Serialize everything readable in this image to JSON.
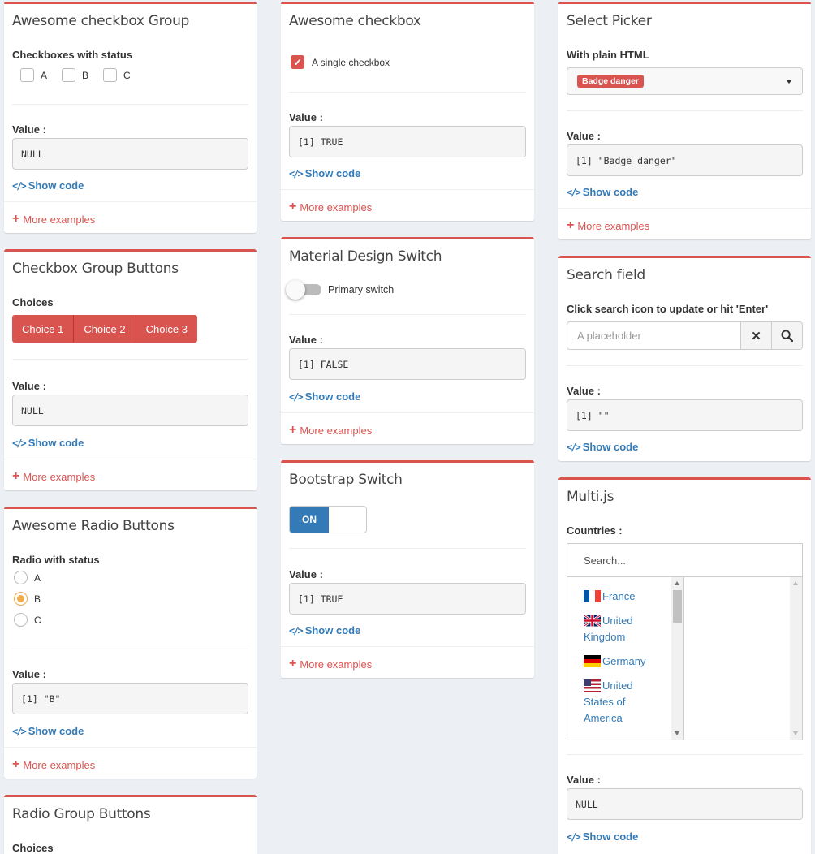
{
  "common": {
    "value_label": "Value :",
    "show_code": "Show code",
    "more_examples": "More examples"
  },
  "col1": {
    "awesome_checkbox_group": {
      "title": "Awesome checkbox Group",
      "label": "Checkboxes with status",
      "options": [
        "A",
        "B",
        "C"
      ],
      "value": "NULL"
    },
    "checkbox_group_buttons": {
      "title": "Checkbox Group Buttons",
      "label": "Choices",
      "options": [
        "Choice 1",
        "Choice 2",
        "Choice 3"
      ],
      "value": "NULL"
    },
    "awesome_radio": {
      "title": "Awesome Radio Buttons",
      "label": "Radio with status",
      "options": [
        "A",
        "B",
        "C"
      ],
      "selected": "B",
      "value": "[1] \"B\""
    },
    "radio_group_buttons": {
      "title": "Radio Group Buttons",
      "label": "Choices"
    }
  },
  "col2": {
    "awesome_checkbox": {
      "title": "Awesome checkbox",
      "checkbox_label": "A single checkbox",
      "checked": true,
      "value": "[1] TRUE"
    },
    "material_switch": {
      "title": "Material Design Switch",
      "switch_label": "Primary switch",
      "value": "[1] FALSE"
    },
    "bootstrap_switch": {
      "title": "Bootstrap Switch",
      "on_label": "ON",
      "value": "[1] TRUE"
    }
  },
  "col3": {
    "select_picker": {
      "title": "Select Picker",
      "label": "With plain HTML",
      "selected_badge": "Badge danger",
      "value": "[1] \"Badge danger\""
    },
    "search_field": {
      "title": "Search field",
      "label": "Click search icon to update or hit 'Enter'",
      "placeholder": "A placeholder",
      "value": "[1] \"\""
    },
    "multijs": {
      "title": "Multi.js",
      "label": "Countries :",
      "search_placeholder": "Search...",
      "countries": [
        "France",
        "United Kingdom",
        "Germany",
        "United States of America"
      ],
      "value": "NULL"
    }
  },
  "colors": {
    "accent": "#d9534f",
    "link": "#337ab7",
    "radio": "#f0ad4e"
  }
}
